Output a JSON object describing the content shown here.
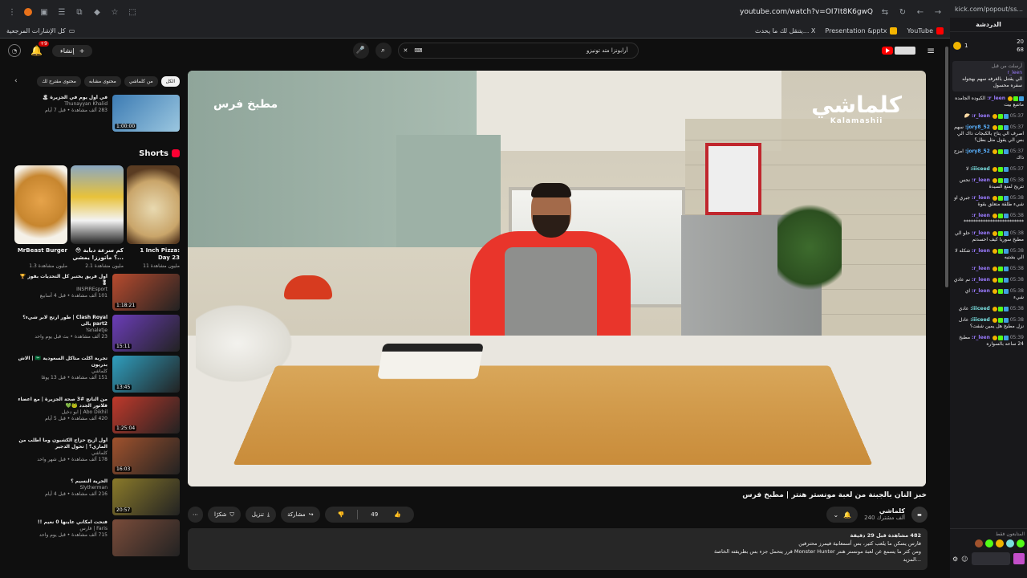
{
  "browser": {
    "url": "youtube.com/watch?v=OI7It8K6gwQ",
    "bookmarks": [
      {
        "label": "YouTube",
        "color": "#ff0000"
      },
      {
        "label": "Presentation &pptx",
        "color": "#f4b400"
      },
      {
        "label": "يتنقل لك ما يحدث... X",
        "color": "#ffffff"
      }
    ],
    "all_bookmarks": "كل الإشارات المرجعية"
  },
  "youtube": {
    "search_query": "أرابونزا متد تونيزو",
    "notif_count": "+9",
    "create_label": "إنشاء"
  },
  "chips": [
    "الكل",
    "من كلماشي",
    "محتوى مشابه",
    "محتوى مقترح لك"
  ],
  "recs_top": [
    {
      "title": "في أول يوم في الجزيرة 🏝",
      "channel": "Thunayyan Khalid",
      "meta": "283 ألف مشاهدة • قبل 7 أيام",
      "duration": "1:00:00",
      "color": "#3c7bb3"
    }
  ],
  "shorts": {
    "label": "Shorts",
    "items": [
      {
        "title": "1 Inch Pizza: Day 23",
        "views": "11 مليون مشاهدة",
        "color": "#b78b5a"
      },
      {
        "title": "كم سرعة دبابة 😳 ؟ ماتورز! يمشي...",
        "views": "2.1 مليون مشاهدة",
        "color": "#c9c9c9"
      },
      {
        "title": "MrBeast Burger",
        "views": "1.3 مليون مشاهدة",
        "color": "#c7862f"
      }
    ]
  },
  "recs": [
    {
      "title": "أول فريق يختبر كل التحديات بفوز 🏆 🎖",
      "channel": "INSPIREsport",
      "meta": "101 ألف مشاهدة • قبل 4 أسابيع",
      "duration": "1:18:21",
      "color": "#b84b2e"
    },
    {
      "title": "Clash Royal | طور ارتح لابر شيء؟ part2 بالى",
      "channel": "Yanaletje",
      "meta": "23 ألف مشاهدة • بث قبل يوم واحد",
      "duration": "15:11",
      "color": "#6b3db8"
    },
    {
      "title": "تجربة أكلت متاكل السعودية 🇸🇦 | الاش بدريون",
      "channel": "كلماشي",
      "meta": "151 ألف مشاهدة • قبل 13 يومًا",
      "duration": "13:45",
      "color": "#2f9fbf"
    },
    {
      "title": "من الناتج #3 صحة الجزيرة | مع اعضاء فلاتور الجدد 🐸💚",
      "channel": "Abo Dikhil | ابو دخيل",
      "meta": "420 ألف مشاهدة • قبل 5 أيام",
      "duration": "1:25:04",
      "color": "#c0392b"
    },
    {
      "title": "أول أزيح حزاج الكشيون وما أطلب من الماري؟ | تحول الدجير",
      "channel": "كلماشي",
      "meta": "178 ألف مشاهدة • قبل شهر واحد",
      "duration": "16:03",
      "color": "#a0522d"
    },
    {
      "title": "الحرية النسيم ؟",
      "channel": "Slytherman",
      "meta": "216 ألف مشاهدة • قبل 4 أيام",
      "duration": "20:57",
      "color": "#8a7a2a"
    },
    {
      "title": "فتحت امكاني عاينها 0 نعيم !!",
      "channel": "Faris | فارس",
      "meta": "715 ألف مشاهدة • قبل يوم واحد",
      "duration": "",
      "color": "#7a4c3a"
    }
  ],
  "video": {
    "title": "خبز النان بالجبنة من لعبة مونستر هنتر | مطبخ فرس",
    "watermark_left": "مطبخ فرس",
    "watermark_right_ar": "كلماشي",
    "watermark_right_en": "Kalamashii",
    "channel": "كلماشي",
    "subscribers": "240 ألف مشترك",
    "likes": "49",
    "share": "مشاركة",
    "download": "تنزيل",
    "thanks": "شكرًا",
    "desc_stats": "482 مشاهدة  قبل 29 دقيقة",
    "desc_line1": "فارس يسكن ما يلعب كثير، بس أسمعانية فيمرز محترفين",
    "desc_line2": "ومن كثر ما يسمع عن لعبة مونستر هنتر Monster Hunter قرر يتحمل جزء بس بطريقته الخاصة",
    "desc_more": "...المزيد"
  },
  "chat": {
    "url": "kick.com/popout/ss...",
    "title": "الدردشة",
    "top_count_a": "20",
    "top_count_b": "68",
    "top_count_c": "1",
    "pinned_label": "أرسلت من قبل",
    "pinned_user": "r_leen",
    "pinned_text": "الي يقتنل بالغرفه سهم بهجوله سفره محسول",
    "messages": [
      {
        "time": "",
        "user": "r_leen:",
        "text": "الكبوده الجامده ماتتبع بيت",
        "ucolor": "#9b7bff"
      },
      {
        "time": "05:37",
        "user": "r_leen:",
        "text": "🥟",
        "ucolor": "#9b7bff"
      },
      {
        "time": "05:37",
        "user": "jory8_52:",
        "text": "سهم اصرف الي يتاح بالكبجات ذاك الي بس الي يقول مثل بطل؟",
        "ucolor": "#5ab2ff"
      },
      {
        "time": "05:37",
        "user": "jory8_52:",
        "text": "امزح ذاك",
        "ucolor": "#5ab2ff"
      },
      {
        "time": "05:37",
        "user": "iiiceed:",
        "text": "لا",
        "ucolor": "#7be0e0"
      },
      {
        "time": "05:38",
        "user": "r_leen:",
        "text": "نحس تتريح لمنع السيدة",
        "ucolor": "#9b7bff"
      },
      {
        "time": "05:38",
        "user": "r_leen:",
        "text": "جبري او شيء طلقة متعلق بقوة",
        "ucolor": "#9b7bff"
      },
      {
        "time": "05:38",
        "user": "r_leen:",
        "text": "*************************",
        "ucolor": "#9b7bff"
      },
      {
        "time": "05:38",
        "user": "r_leen:",
        "text": "حلو الي مطبخ سوريا كيف احسدتم",
        "ucolor": "#9b7bff"
      },
      {
        "time": "05:38",
        "user": "r_leen:",
        "text": "شكله لا الي بشتيه",
        "ucolor": "#9b7bff"
      },
      {
        "time": "05:38",
        "user": "r_leen:",
        "text": "",
        "ucolor": "#9b7bff"
      },
      {
        "time": "05:38",
        "user": "r_leen:",
        "text": "نم عادي",
        "ucolor": "#9b7bff"
      },
      {
        "time": "05:38",
        "user": "r_leen:",
        "text": "اي شيء",
        "ucolor": "#9b7bff"
      },
      {
        "time": "05:38",
        "user": "iiiceed:",
        "text": "عادي",
        "ucolor": "#7be0e0"
      },
      {
        "time": "05:38",
        "user": "iiiceed:",
        "text": "عادل نزل مطبخ هل يمين شفت؟",
        "ucolor": "#7be0e0"
      },
      {
        "time": "05:39",
        "user": "r_leen:",
        "text": "مطبخ 24 ساعه بالسواره",
        "ucolor": "#9b7bff"
      }
    ],
    "viewers_label": "المتابعون فقط"
  },
  "colors": {
    "yt_bg": "#0f0f0f",
    "chip_bg": "#272727",
    "yt_red": "#ff0000",
    "chat_bg": "#18181b"
  }
}
